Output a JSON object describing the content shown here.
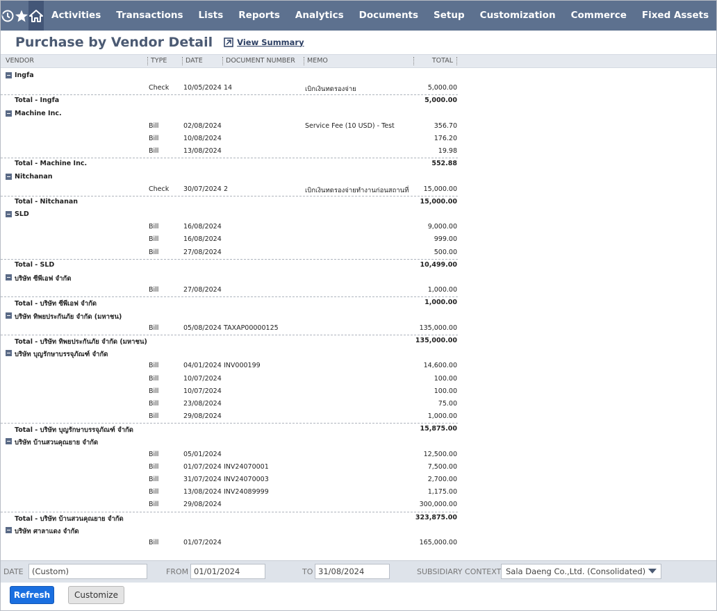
{
  "nav": {
    "icons": [
      "recent-icon",
      "star-icon",
      "home-icon"
    ],
    "items": [
      "Activities",
      "Transactions",
      "Lists",
      "Reports",
      "Analytics",
      "Documents",
      "Setup",
      "Customization",
      "Commerce",
      "Fixed Assets"
    ]
  },
  "header": {
    "title": "Purchase by Vendor Detail",
    "view_summary": "View Summary"
  },
  "columns": [
    "VENDOR",
    "TYPE",
    "DATE",
    "DOCUMENT NUMBER",
    "MEMO",
    "TOTAL"
  ],
  "groups": [
    {
      "vendor": "Ingfa",
      "rows": [
        {
          "type": "Check",
          "date": "10/05/2024",
          "doc": "14",
          "memo": "เบิกเงินทดรองจ่าย",
          "total": "5,000.00"
        }
      ],
      "total_label": "Total - Ingfa",
      "total": "5,000.00"
    },
    {
      "vendor": "Machine Inc.",
      "rows": [
        {
          "type": "Bill",
          "date": "02/08/2024",
          "doc": "",
          "memo": "Service Fee (10 USD) - Test",
          "total": "356.70"
        },
        {
          "type": "Bill",
          "date": "10/08/2024",
          "doc": "",
          "memo": "",
          "total": "176.20"
        },
        {
          "type": "Bill",
          "date": "13/08/2024",
          "doc": "",
          "memo": "",
          "total": "19.98"
        }
      ],
      "total_label": "Total - Machine Inc.",
      "total": "552.88"
    },
    {
      "vendor": "Nitchanan",
      "rows": [
        {
          "type": "Check",
          "date": "30/07/2024",
          "doc": "2",
          "memo": "เบิกเงินทดรองจ่ายทำงานก่อนสถานที่",
          "total": "15,000.00"
        }
      ],
      "total_label": "Total - Nitchanan",
      "total": "15,000.00"
    },
    {
      "vendor": "SLD",
      "rows": [
        {
          "type": "Bill",
          "date": "16/08/2024",
          "doc": "",
          "memo": "",
          "total": "9,000.00"
        },
        {
          "type": "Bill",
          "date": "16/08/2024",
          "doc": "",
          "memo": "",
          "total": "999.00"
        },
        {
          "type": "Bill",
          "date": "27/08/2024",
          "doc": "",
          "memo": "",
          "total": "500.00"
        }
      ],
      "total_label": "Total - SLD",
      "total": "10,499.00"
    },
    {
      "vendor": "บริษัท ซีพีเอฟ จำกัด",
      "rows": [
        {
          "type": "Bill",
          "date": "27/08/2024",
          "doc": "",
          "memo": "",
          "total": "1,000.00"
        }
      ],
      "total_label": "Total - บริษัท ซีพีเอฟ จำกัด",
      "total": "1,000.00"
    },
    {
      "vendor": "บริษัท ทิพยประกันภัย จำกัด (มหาชน)",
      "rows": [
        {
          "type": "Bill",
          "date": "05/08/2024",
          "doc": "TAXAP00000125",
          "memo": "",
          "total": "135,000.00"
        }
      ],
      "total_label": "Total - บริษัท ทิพยประกันภัย จำกัด (มหาชน)",
      "total": "135,000.00"
    },
    {
      "vendor": "บริษัท บุญรักษาบรรจุภัณฑ์ จำกัด",
      "rows": [
        {
          "type": "Bill",
          "date": "04/01/2024",
          "doc": "INV000199",
          "memo": "",
          "total": "14,600.00"
        },
        {
          "type": "Bill",
          "date": "10/07/2024",
          "doc": "",
          "memo": "",
          "total": "100.00"
        },
        {
          "type": "Bill",
          "date": "10/07/2024",
          "doc": "",
          "memo": "",
          "total": "100.00"
        },
        {
          "type": "Bill",
          "date": "23/08/2024",
          "doc": "",
          "memo": "",
          "total": "75.00"
        },
        {
          "type": "Bill",
          "date": "29/08/2024",
          "doc": "",
          "memo": "",
          "total": "1,000.00"
        }
      ],
      "total_label": "Total - บริษัท บุญรักษาบรรจุภัณฑ์ จำกัด",
      "total": "15,875.00"
    },
    {
      "vendor": "บริษัท บ้านสวนคุณยาย จำกัด",
      "rows": [
        {
          "type": "Bill",
          "date": "05/01/2024",
          "doc": "",
          "memo": "",
          "total": "12,500.00"
        },
        {
          "type": "Bill",
          "date": "01/07/2024",
          "doc": "INV24070001",
          "memo": "",
          "total": "7,500.00"
        },
        {
          "type": "Bill",
          "date": "31/07/2024",
          "doc": "INV24070003",
          "memo": "",
          "total": "2,700.00"
        },
        {
          "type": "Bill",
          "date": "13/08/2024",
          "doc": "INV24089999",
          "memo": "",
          "total": "1,175.00"
        },
        {
          "type": "Bill",
          "date": "29/08/2024",
          "doc": "",
          "memo": "",
          "total": "300,000.00"
        }
      ],
      "total_label": "Total - บริษัท บ้านสวนคุณยาย จำกัด",
      "total": "323,875.00"
    },
    {
      "vendor": "บริษัท ศาลาแดง จำกัด",
      "rows": [
        {
          "type": "Bill",
          "date": "01/07/2024",
          "doc": "",
          "memo": "",
          "total": "165,000.00"
        }
      ],
      "total_label": "",
      "total": ""
    }
  ],
  "filters": {
    "date_label": "DATE",
    "date_value": "(Custom)",
    "from_label": "FROM",
    "from_value": "01/01/2024",
    "to_label": "TO",
    "to_value": "31/08/2024",
    "subsidiary_label": "SUBSIDIARY CONTEXT",
    "subsidiary_value": "Sala Daeng Co.,Ltd. (Consolidated)"
  },
  "buttons": {
    "refresh": "Refresh",
    "customize": "Customize"
  }
}
